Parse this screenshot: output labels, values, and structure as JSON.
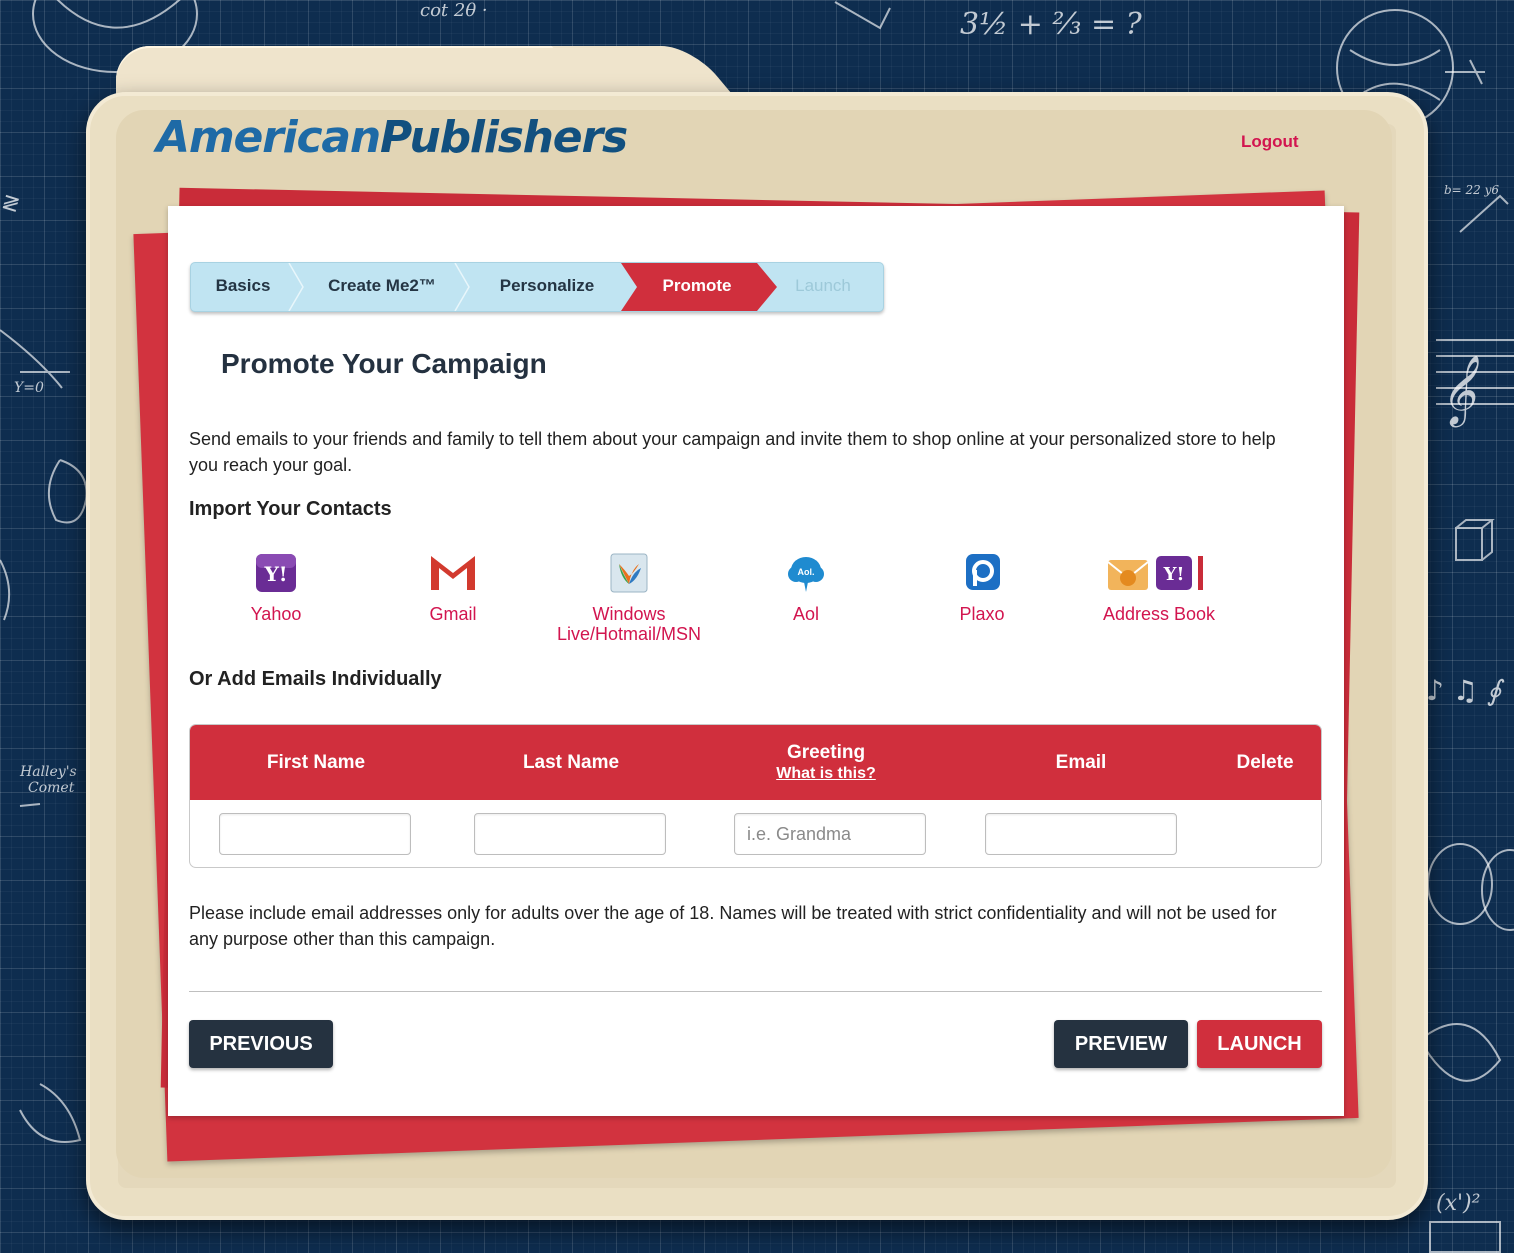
{
  "brand": {
    "name_part1": "American",
    "name_part2": "Publishers"
  },
  "header": {
    "logout_label": "Logout"
  },
  "steps": [
    {
      "label": "Basics",
      "state": "done"
    },
    {
      "label": "Create Me2™",
      "state": "done"
    },
    {
      "label": "Personalize",
      "state": "done"
    },
    {
      "label": "Promote",
      "state": "active"
    },
    {
      "label": "Launch",
      "state": "disabled"
    }
  ],
  "page": {
    "title": "Promote Your Campaign",
    "intro": "Send emails to your friends and family to tell them about your campaign and invite them to shop online at your personalized store to help you reach your goal."
  },
  "import": {
    "heading": "Import Your Contacts",
    "providers": [
      {
        "label": "Yahoo",
        "icon": "yahoo-icon"
      },
      {
        "label": "Gmail",
        "icon": "gmail-icon"
      },
      {
        "label": "Windows Live/Hotmail/MSN",
        "icon": "windows-live-icon"
      },
      {
        "label": "Aol",
        "icon": "aol-icon"
      },
      {
        "label": "Plaxo",
        "icon": "plaxo-icon"
      },
      {
        "label": "Address Book",
        "icon": "address-book-icon"
      }
    ]
  },
  "individual": {
    "heading": "Or Add Emails Individually",
    "columns": {
      "first_name": "First Name",
      "last_name": "Last Name",
      "greeting": "Greeting",
      "greeting_help": "What is this?",
      "email": "Email",
      "delete": "Delete"
    },
    "row": {
      "first_name_value": "",
      "last_name_value": "",
      "greeting_placeholder": "i.e. Grandma",
      "email_value": ""
    }
  },
  "disclaimer": "Please include email addresses only for adults over the age of 18. Names will be treated with strict confidentiality and will not be used for any purpose other than this campaign.",
  "buttons": {
    "previous": "PREVIOUS",
    "preview": "PREVIEW",
    "launch": "LAUNCH"
  },
  "colors": {
    "accent_red": "#d02f3d",
    "link_pink": "#d2154f",
    "dark_button": "#253240",
    "stepper_blue": "#c0e4f2",
    "brand_blue": "#1e6aa6",
    "background_navy": "#0e2d4f",
    "folder_tan": "#e4d8bb"
  }
}
